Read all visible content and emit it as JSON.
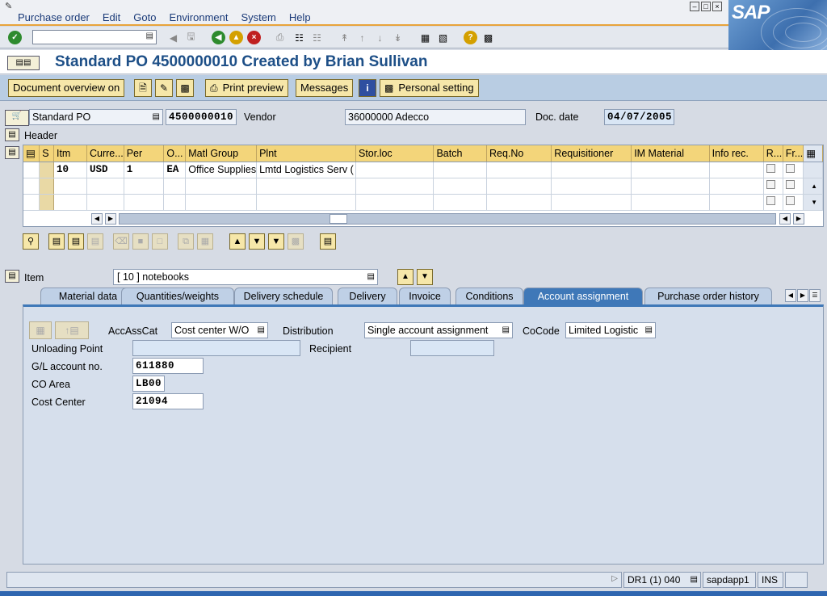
{
  "menu": [
    "Purchase order",
    "Edit",
    "Goto",
    "Environment",
    "System",
    "Help"
  ],
  "brand": "SAP",
  "title": "Standard PO 4500000010 Created by Brian Sullivan",
  "app_toolbar": {
    "doc_overview": "Document overview on",
    "print_preview": "Print preview",
    "messages": "Messages",
    "personal_setting": "Personal setting"
  },
  "header": {
    "doc_type": "Standard PO",
    "po_number": "4500000010",
    "vendor_label": "Vendor",
    "vendor_value": "36000000 Adecco",
    "doc_date_label": "Doc. date",
    "doc_date_value": "04/07/2005",
    "header_label": "Header"
  },
  "grid": {
    "columns": [
      "S",
      "Itm",
      "Curre...",
      "Per",
      "O...",
      "Matl Group",
      "Plnt",
      "Stor.loc",
      "Batch",
      "Req.No",
      "Requisitioner",
      "IM Material",
      "Info rec.",
      "R...",
      "Fr..."
    ],
    "rows": [
      {
        "itm": "10",
        "curr": "USD",
        "per": "1",
        "oun": "EA",
        "matl_group": "Office Supplies",
        "plnt": "Lmtd Logistics Serv (",
        "stor": "",
        "batch": "",
        "reqno": "",
        "requisitioner": "",
        "im": "",
        "info": ""
      }
    ]
  },
  "item": {
    "label": "Item",
    "selected": "[ 10 ] notebooks"
  },
  "tabs": [
    "Material data",
    "Quantities/weights",
    "Delivery schedule",
    "Delivery",
    "Invoice",
    "Conditions",
    "Account assignment",
    "Purchase order history"
  ],
  "account": {
    "accasscat_label": "AccAssCat",
    "accasscat_value": "Cost center W/O",
    "distribution_label": "Distribution",
    "distribution_value": "Single account assignment",
    "cocode_label": "CoCode",
    "cocode_value": "Limited Logistic",
    "unloading_label": "Unloading Point",
    "unloading_value": "",
    "recipient_label": "Recipient",
    "recipient_value": "",
    "gl_label": "G/L account no.",
    "gl_value": "611880",
    "coarea_label": "CO Area",
    "coarea_value": "LB00",
    "costcenter_label": "Cost Center",
    "costcenter_value": "21094"
  },
  "status": {
    "system": "DR1 (1) 040",
    "server": "sapdapp1",
    "mode": "INS"
  }
}
